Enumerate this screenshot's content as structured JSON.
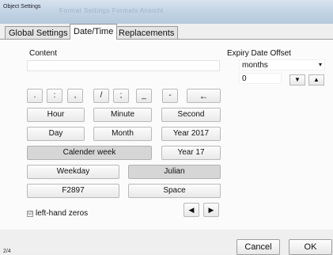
{
  "window": {
    "title": "Object Settings",
    "ghost_title": "Format  Settings  Formats  Ansicht"
  },
  "tabs": [
    {
      "label": "Global Settings"
    },
    {
      "label": "Date/Time"
    },
    {
      "label": "Replacements"
    }
  ],
  "active_tab": "Date/Time",
  "content": {
    "label": "Content",
    "value": ""
  },
  "expiry": {
    "label": "Expiry Date Offset",
    "unit_value": "months",
    "unit_arrow": "▾",
    "offset_value": "0",
    "down_glyph": "▼",
    "up_glyph": "▲"
  },
  "separators": [
    ".",
    ":",
    ",",
    "/",
    ";",
    "_",
    "-",
    "←"
  ],
  "buttons": {
    "hour": "Hour",
    "minute": "Minute",
    "second": "Second",
    "day": "Day",
    "month": "Month",
    "year_full": "Year 2017",
    "calendar_week": "Calender week",
    "year_short": "Year 17",
    "weekday": "Weekday",
    "julian": "Julian",
    "f2897": "F2897",
    "space": "Space",
    "left_arrow": "◀",
    "right_arrow": "▶"
  },
  "options": {
    "leading_zeros_label": "left-hand zeros",
    "leading_zeros_checked": true,
    "check_glyph": "☑"
  },
  "footer": {
    "status": "2/4",
    "cancel_label": "Cancel",
    "ok_label": "OK"
  }
}
